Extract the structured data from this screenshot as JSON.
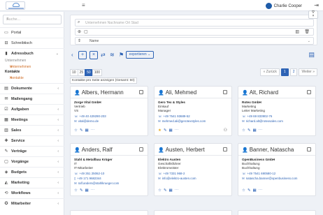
{
  "topbar": {
    "user_name": "Charlie Cooper",
    "menu_icon": "hamburger-icon",
    "logout_icon": "logout-icon"
  },
  "sidebar": {
    "search_placeholder": "Suche...",
    "items": [
      {
        "label": "Portal",
        "icon": "monitor-icon",
        "chevron": ""
      },
      {
        "label": "Schreibtisch",
        "icon": "desk-icon",
        "chevron": ""
      },
      {
        "label": "Adressbuch",
        "icon": "addressbook-icon",
        "chevron": "⌄"
      },
      {
        "label": "Dokumente",
        "icon": "document-icon",
        "chevron": "‹"
      },
      {
        "label": "Mailengang",
        "icon": "mail-icon",
        "chevron": "‹"
      },
      {
        "label": "Aufgaben",
        "icon": "tasks-icon",
        "chevron": "‹"
      },
      {
        "label": "Meetings",
        "icon": "calendar-icon",
        "chevron": "‹"
      },
      {
        "label": "Sales",
        "icon": "sales-icon",
        "chevron": "‹"
      },
      {
        "label": "Service",
        "icon": "service-icon",
        "chevron": "‹"
      },
      {
        "label": "Verträge",
        "icon": "contract-icon",
        "chevron": "‹"
      },
      {
        "label": "Vorgänge",
        "icon": "process-icon",
        "chevron": "‹"
      },
      {
        "label": "Budgets",
        "icon": "budget-icon",
        "chevron": "‹"
      },
      {
        "label": "Marketing",
        "icon": "marketing-icon",
        "chevron": "‹"
      },
      {
        "label": "Workflows",
        "icon": "workflow-icon",
        "chevron": "‹"
      },
      {
        "label": "Mitarbeiter",
        "icon": "employee-icon",
        "chevron": "‹"
      }
    ],
    "sub": {
      "group1": "Unternehmen",
      "link1": "Unternehmen",
      "group2": "Kontakte",
      "link2": "Kontakte"
    }
  },
  "filter": {
    "search_placeholder": "Unternehmen Nachname Ort Stad",
    "name_value": "Name",
    "dropdown_glyph": "⌄"
  },
  "toolbar": {
    "export_label": "exportieren ⌄"
  },
  "pagination": {
    "sizes": [
      "10",
      "25",
      "50",
      "100"
    ],
    "active_size": "50",
    "per_page_text": "Kontakte pro Seite anzeigen (Gesamt: 60)",
    "prev_label": "« Zurück",
    "pages": [
      "1",
      "2"
    ],
    "current_page": "1",
    "next_label": "Weiter »"
  },
  "cards": [
    {
      "name": "Albers, Hermann",
      "company": "Zorge Vital GmbH",
      "line2": "Vertrieb",
      "line3": "VS",
      "phone": "+49 40 429290-203",
      "email": "vital@demo.de"
    },
    {
      "name": "Ali, Mehmed",
      "company": "Gero Tex & Styles",
      "line2": "Einkauf",
      "line3": "Manager",
      "phone": "+49 7541 93689-52",
      "email": "mehmed.ali@gerotexstyles.com"
    },
    {
      "name": "Alt, Richard",
      "company": "Rotex GmbH",
      "line2": "Marketing",
      "line3": "Leiter Marketing",
      "phone": "+49 69 833902-76",
      "email": "richard.alt@rotexsales.com"
    },
    {
      "name": "Anders, Ralf",
      "company": "Stahl & Metallbau Krüger",
      "line2": "IT",
      "line3": "IT-Mitarbeiter",
      "phone": "+49 351 25062-10",
      "phone2": "+49 171 9682344",
      "email": "ralf.anders@stahlkrueger.com"
    },
    {
      "name": "Austen, Herbert",
      "company": "Elektro Austen",
      "line2": "Geschäftsführer",
      "line3": "Elektromeister",
      "phone": "+49 7331 968-2",
      "email": "info@elektro-austen.com"
    },
    {
      "name": "Banner, Natascha",
      "company": "OpenBusiness GmbH",
      "line2": "Buchhaltung",
      "line3": "Buchhaltung",
      "phone": "+49 7541 690580-12",
      "email": "natascha.banner@openbusiness.com"
    }
  ]
}
